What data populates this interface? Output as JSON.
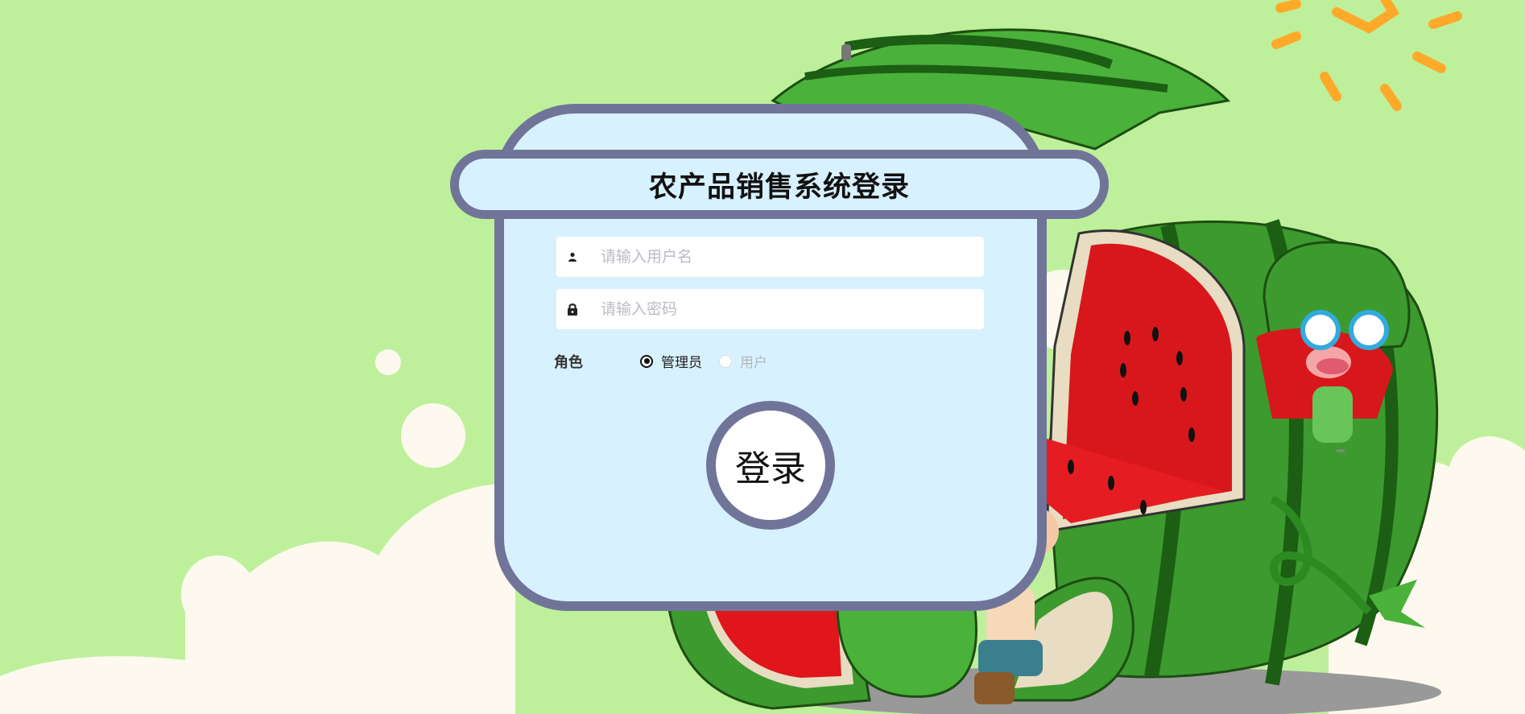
{
  "page": {
    "title": "农产品销售系统登录"
  },
  "form": {
    "username_placeholder": "请输入用户名",
    "password_placeholder": "请输入密码",
    "role_label": "角色",
    "roles": [
      {
        "label": "管理员",
        "checked": true
      },
      {
        "label": "用户",
        "checked": false
      }
    ],
    "login_label": "登录"
  },
  "colors": {
    "background": "#bef09b",
    "card": "#d8f1ff",
    "border": "#717499",
    "watermelon_green": "#3c9a2e",
    "watermelon_red": "#e0161c",
    "sun": "#ffa92a"
  },
  "icons": {
    "username": "user-icon",
    "password": "lock-icon"
  }
}
